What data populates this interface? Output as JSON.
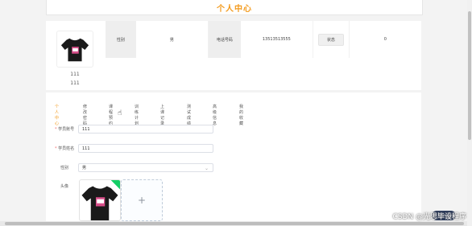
{
  "header": {
    "title": "个人中心"
  },
  "profile": {
    "name_line1": "111",
    "name_line2": "111",
    "info": [
      {
        "label": "性别",
        "value": "男"
      },
      {
        "label": "电话号码",
        "value": "13513513555"
      },
      {
        "label": "状态",
        "value": "0"
      }
    ]
  },
  "tabs": [
    {
      "label": "个人中心",
      "active": true
    },
    {
      "label": "修改密码"
    },
    {
      "label": "课程预约"
    },
    {
      "label": "训练计划"
    },
    {
      "label": "上课记录"
    },
    {
      "label": "测试成绩"
    },
    {
      "label": "高级信息"
    },
    {
      "label": "我的收藏"
    }
  ],
  "form": {
    "student_no": {
      "label": "学员账号",
      "value": "111"
    },
    "student_name": {
      "label": "学员姓名",
      "value": "111"
    },
    "gender": {
      "label": "性别",
      "value": "男"
    },
    "avatar": {
      "label": "头像",
      "add_symbol": "+"
    }
  },
  "watermark": "CSDN @光思毕设程序",
  "colors": {
    "accent": "#f39a1c",
    "required": "#f56c6c"
  }
}
